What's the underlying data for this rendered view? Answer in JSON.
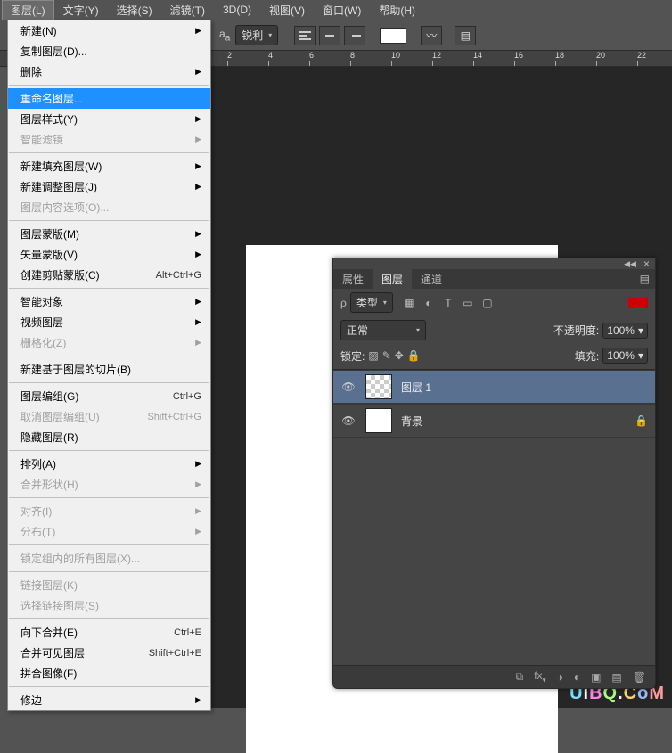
{
  "menubar": {
    "items": [
      "图层(L)",
      "文字(Y)",
      "选择(S)",
      "滤镜(T)",
      "3D(D)",
      "视图(V)",
      "窗口(W)",
      "帮助(H)"
    ],
    "active_index": 0
  },
  "toolbar": {
    "aa_label": "锐利"
  },
  "ruler": {
    "ticks": [
      "2",
      "4",
      "6",
      "8",
      "10",
      "12",
      "14",
      "16",
      "18",
      "20",
      "22"
    ]
  },
  "dropdown": {
    "sections": [
      [
        {
          "label": "新建(N)",
          "arrow": true
        },
        {
          "label": "复制图层(D)...",
          "arrow": false
        },
        {
          "label": "删除",
          "arrow": true
        }
      ],
      [
        {
          "label": "重命名图层...",
          "highlight": true
        },
        {
          "label": "图层样式(Y)",
          "arrow": true
        },
        {
          "label": "智能滤镜",
          "arrow": true,
          "disabled": true
        }
      ],
      [
        {
          "label": "新建填充图层(W)",
          "arrow": true
        },
        {
          "label": "新建调整图层(J)",
          "arrow": true
        },
        {
          "label": "图层内容选项(O)...",
          "disabled": true
        }
      ],
      [
        {
          "label": "图层蒙版(M)",
          "arrow": true
        },
        {
          "label": "矢量蒙版(V)",
          "arrow": true
        },
        {
          "label": "创建剪贴蒙版(C)",
          "shortcut": "Alt+Ctrl+G"
        }
      ],
      [
        {
          "label": "智能对象",
          "arrow": true
        },
        {
          "label": "视频图层",
          "arrow": true
        },
        {
          "label": "栅格化(Z)",
          "arrow": true,
          "disabled": true
        }
      ],
      [
        {
          "label": "新建基于图层的切片(B)"
        }
      ],
      [
        {
          "label": "图层编组(G)",
          "shortcut": "Ctrl+G"
        },
        {
          "label": "取消图层编组(U)",
          "shortcut": "Shift+Ctrl+G",
          "disabled": true
        },
        {
          "label": "隐藏图层(R)"
        }
      ],
      [
        {
          "label": "排列(A)",
          "arrow": true
        },
        {
          "label": "合并形状(H)",
          "arrow": true,
          "disabled": true
        }
      ],
      [
        {
          "label": "对齐(I)",
          "arrow": true,
          "disabled": true
        },
        {
          "label": "分布(T)",
          "arrow": true,
          "disabled": true
        }
      ],
      [
        {
          "label": "锁定组内的所有图层(X)...",
          "disabled": true
        }
      ],
      [
        {
          "label": "链接图层(K)",
          "disabled": true
        },
        {
          "label": "选择链接图层(S)",
          "disabled": true
        }
      ],
      [
        {
          "label": "向下合并(E)",
          "shortcut": "Ctrl+E"
        },
        {
          "label": "合并可见图层",
          "shortcut": "Shift+Ctrl+E"
        },
        {
          "label": "拼合图像(F)"
        }
      ],
      [
        {
          "label": "修边",
          "arrow": true
        }
      ]
    ]
  },
  "layers_panel": {
    "tabs": [
      "属性",
      "图层",
      "通道"
    ],
    "active_tab": 1,
    "filter_label": "类型",
    "blend_mode": "正常",
    "opacity_label": "不透明度:",
    "opacity_value": "100%",
    "lock_label": "锁定:",
    "fill_label": "填充:",
    "fill_value": "100%",
    "layers": [
      {
        "name": "图层 1",
        "suffix": "",
        "thumb": "trans",
        "selected": true,
        "locked": false
      },
      {
        "name": "背景",
        "suffix": "",
        "thumb": "white",
        "selected": false,
        "locked": true
      }
    ],
    "footer_fx": "fx"
  },
  "watermark": "UiBQ.CoM"
}
